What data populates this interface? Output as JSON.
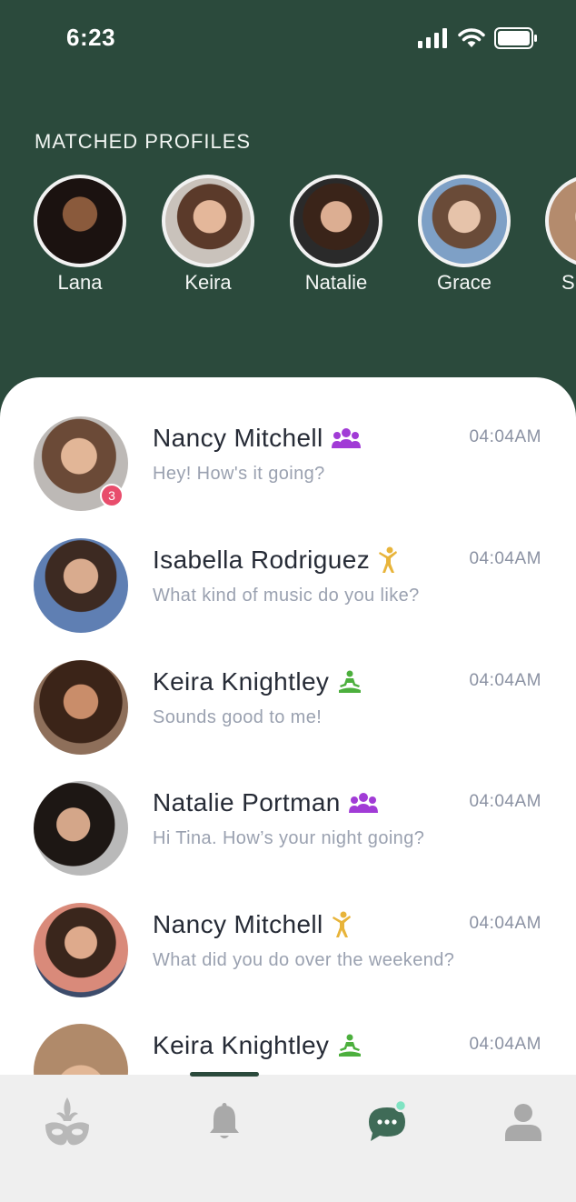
{
  "status_bar": {
    "time": "6:23"
  },
  "matched": {
    "title": "MATCHED  PROFILES",
    "profiles": [
      {
        "name": "Lana"
      },
      {
        "name": "Keira"
      },
      {
        "name": "Natalie"
      },
      {
        "name": "Grace"
      },
      {
        "name": "S"
      }
    ]
  },
  "chats": [
    {
      "name": "Nancy Mitchell",
      "activity_icon": "group-icon",
      "time": "04:04AM",
      "message": "Hey! How's it going?",
      "unread": "3"
    },
    {
      "name": "Isabella Rodriguez",
      "activity_icon": "dance-icon",
      "time": "04:04AM",
      "message": "What kind of music do you like?"
    },
    {
      "name": "Keira Knightley",
      "activity_icon": "yoga-icon",
      "time": "04:04AM",
      "message": "Sounds good to me!"
    },
    {
      "name": "Natalie Portman",
      "activity_icon": "group-icon",
      "time": "04:04AM",
      "message": "Hi Tina. How’s your night going?"
    },
    {
      "name": "Nancy Mitchell",
      "activity_icon": "dance-icon",
      "time": "04:04AM",
      "message": "What did you do over the weekend?"
    },
    {
      "name": "Keira Knightley",
      "activity_icon": "yoga-icon",
      "time": "04:04AM",
      "message": ""
    }
  ],
  "tabs": [
    {
      "icon": "mask-icon"
    },
    {
      "icon": "bell-icon"
    },
    {
      "icon": "chat-icon"
    },
    {
      "icon": "profile-icon"
    }
  ],
  "colors": {
    "header_bg": "#2b4a3c",
    "unread_badge": "#e84d6c",
    "group_icon": "#a13bd6",
    "dance_icon": "#e8b43a",
    "yoga_icon": "#4caf3d",
    "active_tab": "#3f6b57"
  }
}
